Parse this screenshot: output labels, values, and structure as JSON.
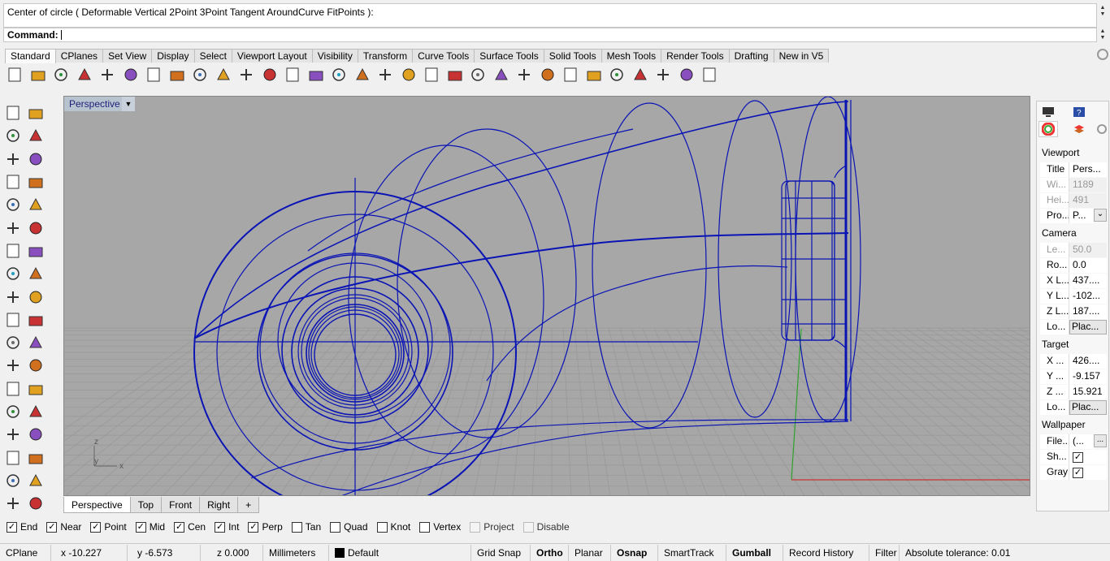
{
  "command": {
    "history": "Center of circle ( Deformable  Vertical  2Point  3Point  Tangent  AroundCurve  FitPoints ):",
    "prompt_label": "Command:",
    "value": ""
  },
  "toolbar_tabs": [
    "Standard",
    "CPlanes",
    "Set View",
    "Display",
    "Select",
    "Viewport Layout",
    "Visibility",
    "Transform",
    "Curve Tools",
    "Surface Tools",
    "Solid Tools",
    "Mesh Tools",
    "Render Tools",
    "Drafting",
    "New in V5"
  ],
  "toolbar_icons": [
    "new-file-icon",
    "open-file-icon",
    "save-icon",
    "print-icon",
    "import-icon",
    "cut-icon",
    "copy-icon",
    "paste-icon",
    "undo-icon",
    "pan-icon",
    "rotate-view-icon",
    "zoom-icon",
    "zoom-window-icon",
    "zoom-extents-icon",
    "zoom-selected-icon",
    "rotate-camera-icon",
    "four-viewports-icon",
    "car-icon",
    "grid-options-icon",
    "cplane-icon",
    "osnap-icon",
    "lock-icon",
    "layer-icon",
    "color-wheel-icon",
    "render-sphere-icon",
    "shaded-sphere-icon",
    "blue-sphere-icon",
    "lights-icon",
    "settings-gears-icon",
    "dimension-icon",
    "help-icon"
  ],
  "left_tools": [
    [
      "select-arrow-icon",
      "point-icon"
    ],
    [
      "polyline-icon",
      "curve-points-icon"
    ],
    [
      "circle-icon",
      "ellipse-icon"
    ],
    [
      "arc-icon",
      "rectangle-icon"
    ],
    [
      "polygon-icon",
      "fillet-curve-icon"
    ],
    [
      "surface-points-icon",
      "patch-icon"
    ],
    [
      "box-icon",
      "sphere-icon"
    ],
    [
      "cylinder-icon",
      "mesh-plane-icon"
    ],
    [
      "boolean-icon",
      "extrude-icon"
    ],
    [
      "trim-icon",
      "split-icon"
    ],
    [
      "group-icon",
      "points-cloud-icon"
    ],
    [
      "curve-offset-icon",
      "curve-blend-icon"
    ],
    [
      "text-icon",
      "scale-icon"
    ],
    [
      "array-icon",
      "copy-move-icon"
    ],
    [
      "block-icon",
      "dimension-ruler-icon"
    ],
    [
      "grid-dots-icon",
      "layer-stack-icon"
    ],
    [
      "material-icon",
      "check-icon"
    ],
    [
      "analyze-icon",
      "paint-bucket-icon"
    ]
  ],
  "viewport": {
    "title": "Perspective",
    "axis_labels": {
      "z": "z",
      "y": "y",
      "x": "x"
    }
  },
  "viewport_tabs": [
    "Perspective",
    "Top",
    "Front",
    "Right"
  ],
  "viewport_add": "+",
  "osnaps": [
    {
      "label": "End",
      "checked": true,
      "enabled": true
    },
    {
      "label": "Near",
      "checked": true,
      "enabled": true
    },
    {
      "label": "Point",
      "checked": true,
      "enabled": true
    },
    {
      "label": "Mid",
      "checked": true,
      "enabled": true
    },
    {
      "label": "Cen",
      "checked": true,
      "enabled": true
    },
    {
      "label": "Int",
      "checked": true,
      "enabled": true
    },
    {
      "label": "Perp",
      "checked": true,
      "enabled": true
    },
    {
      "label": "Tan",
      "checked": false,
      "enabled": true
    },
    {
      "label": "Quad",
      "checked": false,
      "enabled": true
    },
    {
      "label": "Knot",
      "checked": false,
      "enabled": true
    },
    {
      "label": "Vertex",
      "checked": false,
      "enabled": true
    },
    {
      "label": "Project",
      "checked": false,
      "enabled": false
    },
    {
      "label": "Disable",
      "checked": false,
      "enabled": false
    }
  ],
  "status": {
    "cplane": "CPlane",
    "x": "x -10.227",
    "y": "y -6.573",
    "z": "z 0.000",
    "units": "Millimeters",
    "layer": "Default",
    "layer_color": "#000000",
    "grid_snap": "Grid Snap",
    "ortho": "Ortho",
    "planar": "Planar",
    "osnap": "Osnap",
    "smarttrack": "SmartTrack",
    "gumball": "Gumball",
    "record_history": "Record History",
    "filter": "Filter",
    "tolerance": "Absolute tolerance: 0.01"
  },
  "properties": {
    "viewport_header": "Viewport",
    "title_k": "Title",
    "title_v": "Pers...",
    "width_k": "Wi...",
    "width_v": "1189",
    "height_k": "Hei...",
    "height_v": "491",
    "proj_k": "Pro...",
    "proj_v": "P...",
    "camera_header": "Camera",
    "lens_k": "Le...",
    "lens_v": "50.0",
    "rot_k": "Ro...",
    "rot_v": "0.0",
    "xloc_k": "X L...",
    "xloc_v": "437....",
    "yloc_k": "Y L...",
    "yloc_v": "-102...",
    "zloc_k": "Z L...",
    "zloc_v": "187....",
    "loc_k": "Lo...",
    "loc_btn": "Plac...",
    "target_header": "Target",
    "tx_k": "X ...",
    "tx_v": "426....",
    "ty_k": "Y ...",
    "ty_v": "-9.157",
    "tz_k": "Z ...",
    "tz_v": "15.921",
    "tloc_k": "Lo...",
    "tloc_btn": "Plac...",
    "wallpaper_header": "Wallpaper",
    "file_k": "File...",
    "file_v": "(...",
    "file_btn": "...",
    "show_k": "Sh...",
    "gray_k": "Gray"
  },
  "colors": {
    "wire": "#0a14b4",
    "viewport_bg": "#a7a7a7",
    "grid": "#9a9a9a"
  }
}
